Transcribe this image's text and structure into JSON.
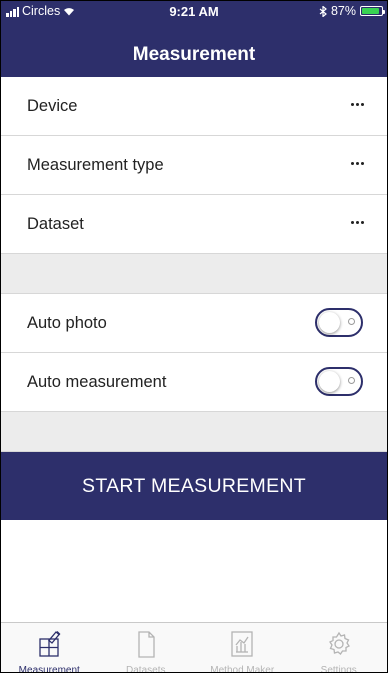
{
  "status_bar": {
    "carrier": "Circles",
    "time": "9:21 AM",
    "battery_percent": "87%",
    "battery_level": 0.87,
    "bluetooth_icon": "bluetooth-icon",
    "wifi_icon": "wifi-icon"
  },
  "header": {
    "title": "Measurement"
  },
  "settings": {
    "rows": [
      {
        "label": "Device",
        "more_icon": "ellipsis-icon"
      },
      {
        "label": "Measurement type",
        "more_icon": "ellipsis-icon"
      },
      {
        "label": "Dataset",
        "more_icon": "ellipsis-icon"
      }
    ],
    "toggles": [
      {
        "label": "Auto photo",
        "on": false
      },
      {
        "label": "Auto measurement",
        "on": false
      }
    ]
  },
  "actions": {
    "start_label": "START MEASUREMENT"
  },
  "tabs": [
    {
      "label": "Measurement",
      "icon": "measurement-icon",
      "active": true
    },
    {
      "label": "Datasets",
      "icon": "document-icon",
      "active": false
    },
    {
      "label": "Method Maker",
      "icon": "chart-icon",
      "active": false
    },
    {
      "label": "Settings",
      "icon": "gear-icon",
      "active": false
    }
  ],
  "colors": {
    "primary": "#2d2f6b",
    "battery": "#39d353",
    "inactive_tab": "#b4b4b4"
  }
}
